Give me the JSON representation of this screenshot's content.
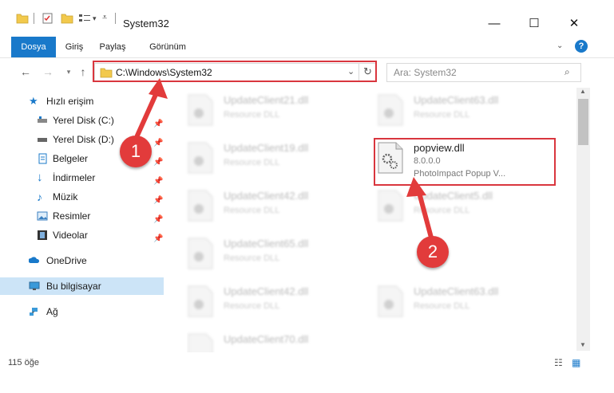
{
  "window": {
    "title": "System32"
  },
  "ribbon": {
    "tabs": [
      "Dosya",
      "Giriş",
      "Paylaş",
      "Görünüm"
    ]
  },
  "address": {
    "path": "C:\\Windows\\System32"
  },
  "search": {
    "placeholder": "Ara: System32"
  },
  "sidebar": {
    "quick_access": "Hızlı erişim",
    "items": [
      "Yerel Disk (C:)",
      "Yerel Disk (D:)",
      "Belgeler",
      "İndirmeler",
      "Müzik",
      "Resimler",
      "Videolar"
    ],
    "onedrive": "OneDrive",
    "this_pc": "Bu bilgisayar",
    "network": "Ağ"
  },
  "files": {
    "left": [
      {
        "name": "UpdateClient21.dll",
        "desc": "Resource DLL"
      },
      {
        "name": "UpdateClient19.dll",
        "desc": "Resource DLL"
      },
      {
        "name": "UpdateClient42.dll",
        "desc": "Resource DLL"
      },
      {
        "name": "UpdateClient65.dll",
        "desc": "Resource DLL"
      },
      {
        "name": "UpdateClient42.dll",
        "desc": "Resource DLL"
      },
      {
        "name": "UpdateClient70.dll",
        "desc": "Resource DLL"
      }
    ],
    "right": [
      {
        "name": "UpdateClient63.dll",
        "desc": "Resource DLL"
      },
      {
        "name": "UpdateClient5.dll",
        "desc": "Resource DLL"
      },
      {
        "name": "UpdateClient63.dll",
        "desc": "Resource DLL"
      }
    ],
    "selected": {
      "name": "popview.dll",
      "version": "8.0.0.0",
      "desc": "PhotoImpact Popup V..."
    }
  },
  "annotations": {
    "step1": "1",
    "step2": "2"
  },
  "status": {
    "count": "115 öğe"
  },
  "colors": {
    "accent": "#1979ca",
    "highlight": "#d9363e",
    "selection": "#cce4f7"
  }
}
